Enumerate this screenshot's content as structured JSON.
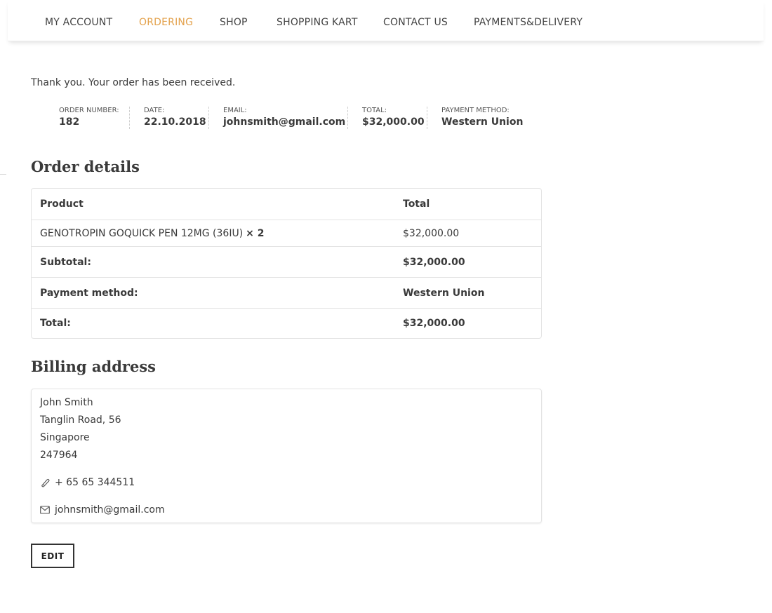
{
  "nav": {
    "items": [
      {
        "label": "MY ACCOUNT",
        "active": false
      },
      {
        "label": "ORDERING",
        "active": true
      },
      {
        "label": "SHOP",
        "active": false
      },
      {
        "label": "SHOPPING KART",
        "active": false
      },
      {
        "label": "CONTACT US",
        "active": false
      },
      {
        "label": "PAYMENTS&DELIVERY",
        "active": false
      }
    ],
    "active_color": "#e3a14b"
  },
  "notice": "Thank you. Your order has been received.",
  "overview": [
    {
      "label": "ORDER NUMBER:",
      "value": "182"
    },
    {
      "label": "DATE:",
      "value": "22.10.2018"
    },
    {
      "label": "EMAIL:",
      "value": "johnsmith@gmail.com"
    },
    {
      "label": "TOTAL:",
      "value": "$32,000.00"
    },
    {
      "label": "PAYMENT METHOD:",
      "value": "Western Union"
    }
  ],
  "order_details": {
    "title": "Order details",
    "header": {
      "product": "Product",
      "total": "Total"
    },
    "item": {
      "name": "GENOTROPIN GOQUICK PEN 12MG (36IU)",
      "qty": "× 2",
      "total": "$32,000.00"
    },
    "summary": [
      {
        "label": "Subtotal:",
        "value": "$32,000.00"
      },
      {
        "label": "Payment method:",
        "value": "Western Union"
      },
      {
        "label": "Total:",
        "value": "$32,000.00"
      }
    ]
  },
  "billing": {
    "title": "Billing address",
    "lines": [
      "John Smith",
      "Tanglin Road, 56",
      "Singapore",
      "247964"
    ],
    "phone": "+ 65 65 344511",
    "email": "johnsmith@gmail.com",
    "phone_icon": "phone-icon",
    "email_icon": "envelope-icon"
  },
  "edit_label": "EDIT"
}
